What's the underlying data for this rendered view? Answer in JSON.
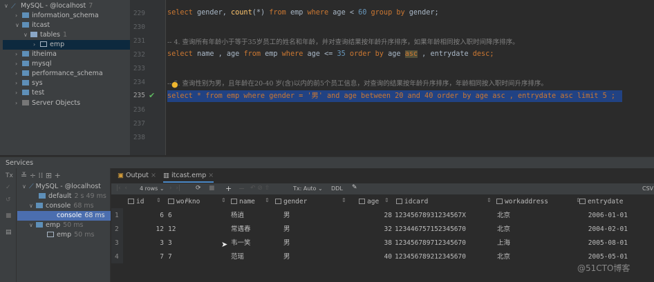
{
  "db_tree": {
    "root": "MySQL - @localhost",
    "root_count": "7",
    "items": [
      {
        "label": "information_schema"
      },
      {
        "label": "itcast"
      },
      {
        "label": "tables",
        "count": "1"
      },
      {
        "label": "emp"
      },
      {
        "label": "itheima"
      },
      {
        "label": "mysql"
      },
      {
        "label": "performance_schema"
      },
      {
        "label": "sys"
      },
      {
        "label": "test"
      },
      {
        "label": "Server Objects"
      }
    ]
  },
  "editor": {
    "line_numbers": [
      "229",
      "230",
      "231",
      "232",
      "233",
      "234",
      "235",
      "236",
      "237",
      "238"
    ],
    "line229": [
      "select",
      "gender,",
      "count",
      "(*)",
      "from",
      "emp",
      "where",
      "age <",
      "60",
      "group by",
      "gender;"
    ],
    "comment231": "-- 4. 查询所有年龄小于等于35岁员工的姓名和年龄，并对查询结果按年龄升序排序，如果年龄相同按入职时间降序排序。",
    "line232": [
      "select",
      "name , age",
      "from",
      "emp",
      "where",
      "age <=",
      "35",
      "order by",
      "age",
      "asc",
      ", entrydate",
      "desc",
      ";"
    ],
    "comment234": "-- 5. 查询性别为男，且年龄在20-40 岁(含)以内的前5个员工信息，对查询的结果按年龄升序排序，年龄相同按入职时间升序排序。",
    "line235": "select * from emp where gender = '男' and age between 20 and 40 order by age asc , entrydate asc limit 5 ;"
  },
  "services": {
    "title": "Services",
    "tree": [
      {
        "label": "MySQL - @localhost"
      },
      {
        "label": "default",
        "time": "2 s 49 ms"
      },
      {
        "label": "console",
        "time": "68 ms"
      },
      {
        "label": "console",
        "time": "68 ms"
      },
      {
        "label": "emp",
        "time": "50 ms"
      },
      {
        "label": "emp",
        "time": "50 ms"
      }
    ],
    "tx_label": "Tx"
  },
  "results": {
    "tabs": [
      {
        "label": "Output"
      },
      {
        "label": "itcast.emp"
      }
    ],
    "rows_label": "4 rows",
    "tx_mode": "Tx: Auto",
    "ddl": "DDL",
    "csv": "CSV",
    "columns": [
      "id",
      "workno",
      "name",
      "gender",
      "age",
      "idcard",
      "workaddress",
      "entrydate"
    ],
    "rows": [
      [
        "1",
        "6",
        "6",
        "杨逍",
        "男",
        "28",
        "12345678931234567X",
        "北京",
        "2006-01-01"
      ],
      [
        "2",
        "12",
        "12",
        "常遇春",
        "男",
        "32",
        "123446757152345670",
        "北京",
        "2004-02-01"
      ],
      [
        "3",
        "3",
        "3",
        "韦一笑",
        "男",
        "38",
        "123456789712345670",
        "上海",
        "2005-08-01"
      ],
      [
        "4",
        "7",
        "7",
        "范瑶",
        "男",
        "40",
        "123456789212345670",
        "北京",
        "2005-05-01"
      ]
    ]
  },
  "watermark": "@51CTO博客"
}
